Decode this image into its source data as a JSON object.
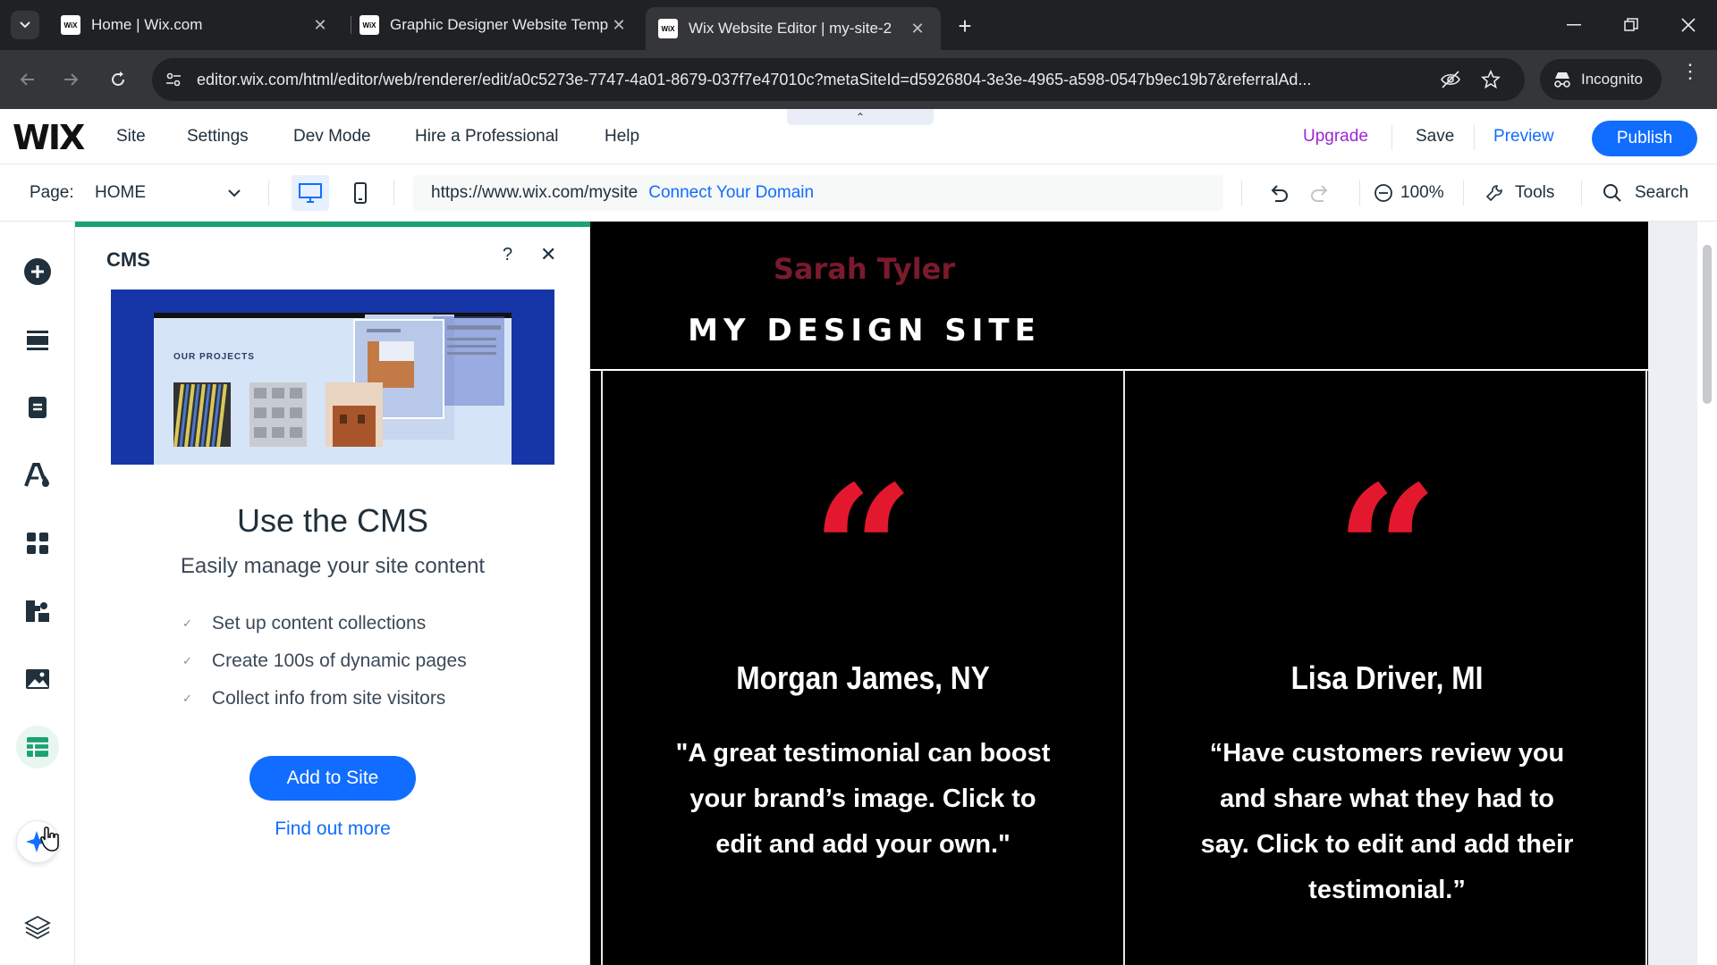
{
  "browser": {
    "tabs": [
      {
        "title": "Home | Wix.com",
        "favicon": "WiX"
      },
      {
        "title": "Graphic Designer Website Temp",
        "favicon": "WiX"
      },
      {
        "title": "Wix Website Editor | my-site-2",
        "favicon": "WiX",
        "active": true
      }
    ],
    "url": "editor.wix.com/html/editor/web/renderer/edit/a0c5273e-7747-4a01-8679-037f7e47010c?metaSiteId=d5926804-3e3e-4965-a598-0547b9ec19b7&referralAd...",
    "incognito_label": "Incognito"
  },
  "wix_top": {
    "logo": "WIX",
    "menu": [
      "Site",
      "Settings",
      "Dev Mode",
      "Hire a Professional",
      "Help"
    ],
    "upgrade": "Upgrade",
    "save": "Save",
    "preview": "Preview",
    "publish": "Publish",
    "colors": {
      "publish": "#116dff",
      "upgrade": "#9a27d5"
    }
  },
  "page_bar": {
    "page_label": "Page:",
    "page_value": "HOME",
    "site_url": "https://www.wix.com/mysite",
    "connect_domain": "Connect Your Domain",
    "zoom": "100%",
    "tools": "Tools",
    "search": "Search"
  },
  "cms_panel": {
    "title": "CMS",
    "hero_label": "OUR PROJECTS",
    "heading": "Use the CMS",
    "subheading": "Easily manage your site content",
    "features": [
      "Set up content collections",
      "Create 100s of dynamic pages",
      "Collect info from site visitors"
    ],
    "add_button": "Add to Site",
    "find_more": "Find out more",
    "colors": {
      "accent_line": "#1aa36f",
      "hero_bg": "#1636a7"
    }
  },
  "site": {
    "name": "Sarah Tyler",
    "tagline": "MY DESIGN SITE",
    "testimonials": [
      {
        "name": "Morgan James, NY",
        "quote": "\"A great testimonial can boost your brand’s image. Click to edit and add your own.\""
      },
      {
        "name": "Lisa Driver, MI",
        "quote": "“Have customers review you and share what they had to say. Click to edit and add their testimonial.”"
      }
    ],
    "colors": {
      "background": "#000000",
      "quote_mark": "#e3182f",
      "name": "#7a1a2d"
    }
  }
}
